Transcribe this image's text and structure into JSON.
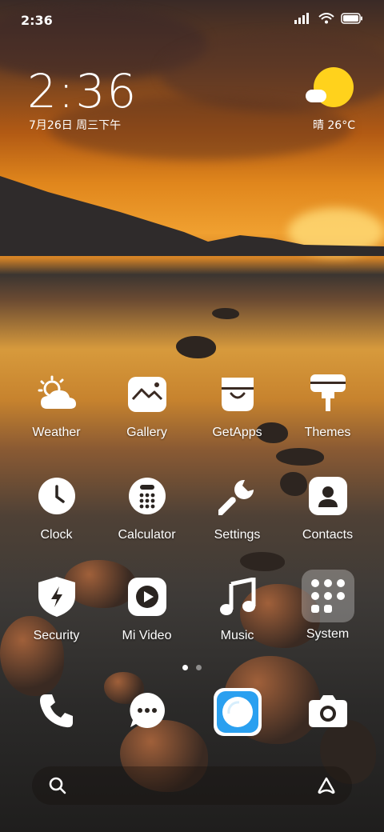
{
  "status_bar": {
    "time": "2:36"
  },
  "clock_widget": {
    "time": "2:36",
    "date": "7月26日 周三下午"
  },
  "weather_widget": {
    "text": "晴 26°C"
  },
  "apps": [
    {
      "label": "Weather",
      "icon": "weather-icon"
    },
    {
      "label": "Gallery",
      "icon": "gallery-icon"
    },
    {
      "label": "GetApps",
      "icon": "getapps-icon"
    },
    {
      "label": "Themes",
      "icon": "themes-icon"
    },
    {
      "label": "Clock",
      "icon": "clock-icon"
    },
    {
      "label": "Calculator",
      "icon": "calculator-icon"
    },
    {
      "label": "Settings",
      "icon": "settings-icon"
    },
    {
      "label": "Contacts",
      "icon": "contacts-icon"
    },
    {
      "label": "Security",
      "icon": "security-icon"
    },
    {
      "label": "Mi Video",
      "icon": "video-icon"
    },
    {
      "label": "Music",
      "icon": "music-icon"
    },
    {
      "label": "System",
      "icon": "system-folder-icon"
    }
  ],
  "dock": [
    {
      "icon": "phone-icon"
    },
    {
      "icon": "messages-icon"
    },
    {
      "icon": "browser-icon"
    },
    {
      "icon": "camera-icon"
    }
  ],
  "page_indicator": {
    "pages": 2,
    "current": 1
  },
  "colors": {
    "sun": "#ffd21c",
    "browser": "#2aa0f0"
  }
}
